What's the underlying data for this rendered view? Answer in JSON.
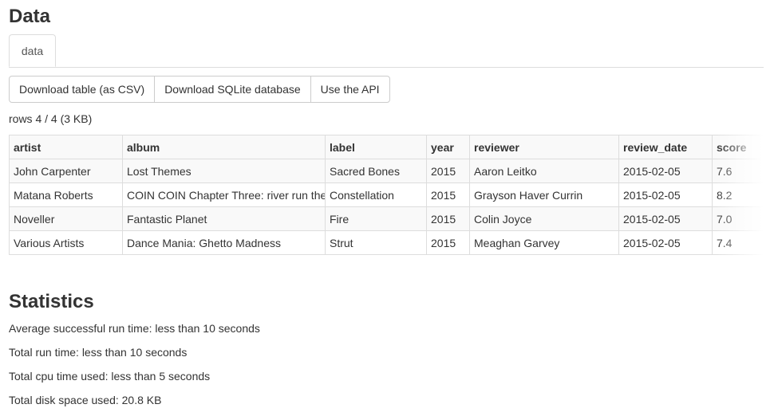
{
  "data_section": {
    "title": "Data",
    "tabs": [
      {
        "label": "data"
      }
    ],
    "buttons": {
      "download_csv": "Download table (as CSV)",
      "download_sqlite": "Download SQLite database",
      "use_api": "Use the API"
    },
    "rows_info": "rows 4 / 4 (3 KB)",
    "table": {
      "columns": [
        "artist",
        "album",
        "label",
        "year",
        "reviewer",
        "review_date",
        "score"
      ],
      "rows": [
        [
          "John Carpenter",
          "Lost Themes",
          "Sacred Bones",
          "2015",
          "Aaron Leitko",
          "2015-02-05",
          "7.6"
        ],
        [
          "Matana Roberts",
          "COIN COIN Chapter Three: river run thee",
          "Constellation",
          "2015",
          "Grayson Haver Currin",
          "2015-02-05",
          "8.2"
        ],
        [
          "Noveller",
          "Fantastic Planet",
          "Fire",
          "2015",
          "Colin Joyce",
          "2015-02-05",
          "7.0"
        ],
        [
          "Various Artists",
          "Dance Mania: Ghetto Madness",
          "Strut",
          "2015",
          "Meaghan Garvey",
          "2015-02-05",
          "7.4"
        ]
      ]
    }
  },
  "statistics": {
    "title": "Statistics",
    "lines": [
      "Average successful run time: less than 10 seconds",
      "Total run time: less than 10 seconds",
      "Total cpu time used: less than 5 seconds",
      "Total disk space used: 20.8 KB"
    ]
  }
}
